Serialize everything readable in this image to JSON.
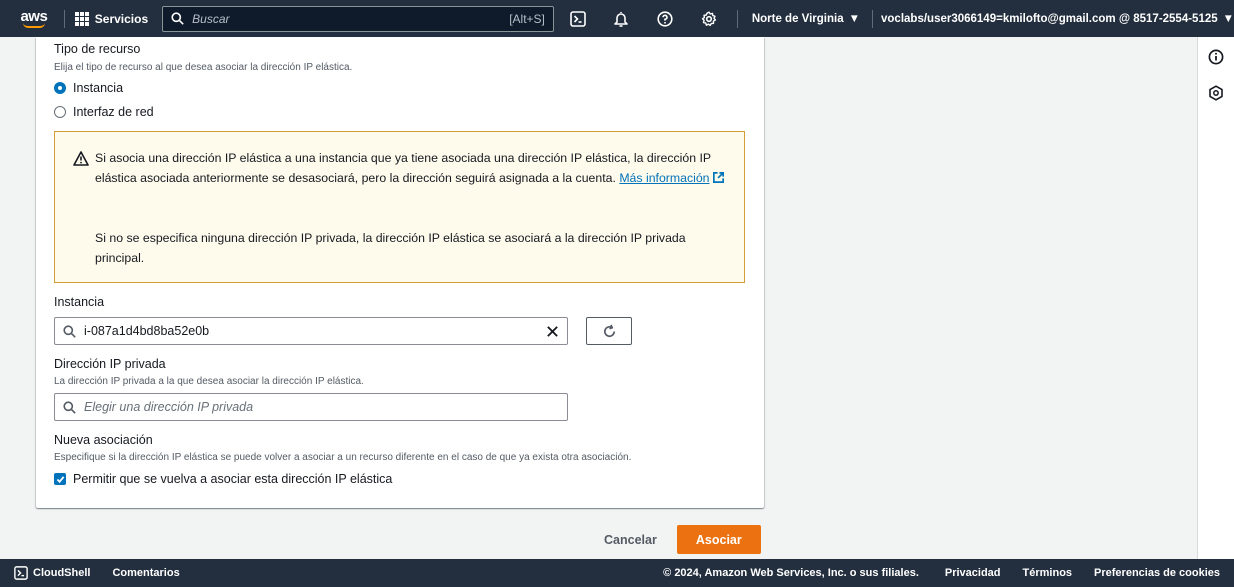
{
  "topnav": {
    "logo_text": "aws",
    "services_label": "Servicios",
    "search_placeholder": "Buscar",
    "search_shortcut": "[Alt+S]",
    "region": "Norte de Virginia",
    "account": "voclabs/user3066149=kmilofto@gmail.com @ 8517-2554-5125"
  },
  "form": {
    "resource_type": {
      "label": "Tipo de recurso",
      "description": "Elija el tipo de recurso al que desea asociar la dirección IP elástica.",
      "options": [
        "Instancia",
        "Interfaz de red"
      ],
      "selected": "Instancia"
    },
    "alert": {
      "text1": "Si asocia una dirección IP elástica a una instancia que ya tiene asociada una dirección IP elástica, la dirección IP elástica asociada anteriormente se desasociará, pero la dirección seguirá asignada a la cuenta.",
      "link": "Más información",
      "text2": "Si no se especifica ninguna dirección IP privada, la dirección IP elástica se asociará a la dirección IP privada principal."
    },
    "instance": {
      "label": "Instancia",
      "value": "i-087a1d4bd8ba52e0b"
    },
    "private_ip": {
      "label": "Dirección IP privada",
      "description": "La dirección IP privada a la que desea asociar la dirección IP elástica.",
      "placeholder": "Elegir una dirección IP privada"
    },
    "reassoc": {
      "label": "Nueva asociación",
      "description": "Especifique si la dirección IP elástica se puede volver a asociar a un recurso diferente en el caso de que ya exista otra asociación.",
      "checkbox_label": "Permitir que se vuelva a asociar esta dirección IP elástica",
      "checked": true
    }
  },
  "actions": {
    "cancel": "Cancelar",
    "submit": "Asociar"
  },
  "footer": {
    "cloudshell": "CloudShell",
    "feedback": "Comentarios",
    "copyright": "© 2024, Amazon Web Services, Inc. o sus filiales.",
    "privacy": "Privacidad",
    "terms": "Términos",
    "cookies": "Preferencias de cookies"
  },
  "colors": {
    "nav_bg": "#232f3e",
    "primary": "#ec7211",
    "link": "#0073bb",
    "warning_bg": "#fefaec",
    "warning_border": "#d39e3a"
  }
}
